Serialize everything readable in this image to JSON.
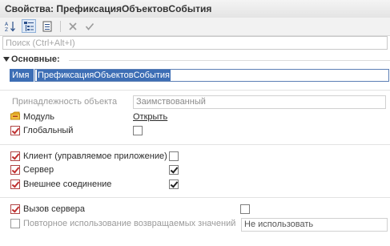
{
  "window": {
    "title": "Свойства: ПрефиксацияОбъектовСобытия"
  },
  "toolbar": {
    "buttons": [
      {
        "name": "sort-alphabet",
        "glyph": "A↓Z"
      },
      {
        "name": "categories",
        "glyph": ""
      },
      {
        "name": "filter",
        "glyph": ""
      },
      {
        "name": "clear",
        "glyph": "✕"
      },
      {
        "name": "confirm",
        "glyph": "✔"
      }
    ]
  },
  "search": {
    "placeholder": "Поиск (Ctrl+Alt+I)",
    "value": ""
  },
  "section": {
    "label": "Основные:"
  },
  "name": {
    "label": "Имя",
    "value": "ПрефиксацияОбъектовСобытия"
  },
  "ownership": {
    "label": "Принадлежность объекта",
    "value": "Заимствованный"
  },
  "module": {
    "label": "Модуль",
    "action": "Открыть"
  },
  "global": {
    "label": "Глобальный",
    "checked": false
  },
  "client": {
    "label": "Клиент (управляемое приложение)",
    "checked": false
  },
  "server": {
    "label": "Сервер",
    "checked": true
  },
  "external": {
    "label": "Внешнее соединение",
    "checked": true
  },
  "server_call": {
    "label": "Вызов сервера",
    "checked": false
  },
  "reuse": {
    "label": "Повторное использование возвращаемых значений",
    "value": "Не использовать"
  },
  "colors": {
    "accent": "#3d6eb5",
    "flag_red": "#c03030",
    "module_icon": "#e0a020"
  }
}
